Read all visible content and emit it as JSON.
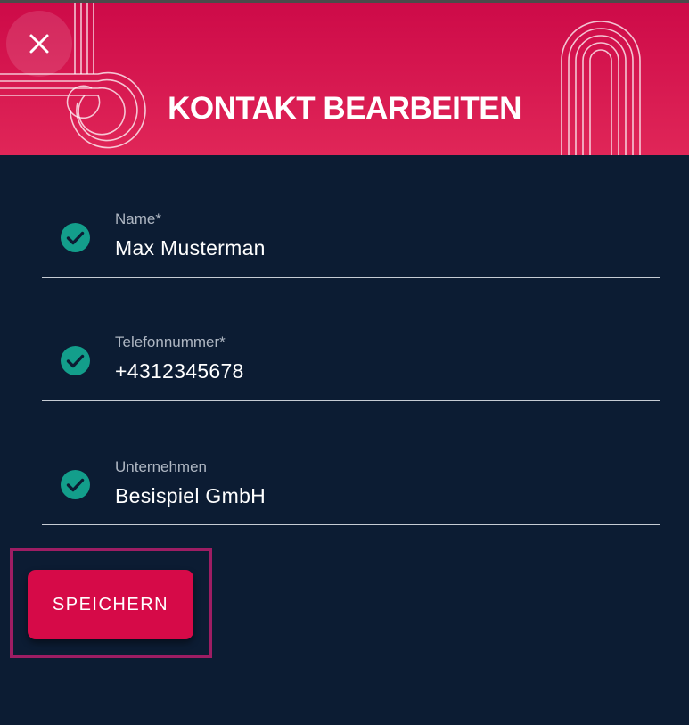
{
  "dialog": {
    "title": "KONTAKT BEARBEITEN",
    "close_icon": "close-icon",
    "accent_color": "#d60a48",
    "background_color": "#0c1c33"
  },
  "form": {
    "fields": [
      {
        "label": "Name*",
        "value": "Max Musterman",
        "status_icon": "check-circle-icon",
        "status_color": "#139e8b"
      },
      {
        "label": "Telefonnummer*",
        "value": "+4312345678",
        "status_icon": "check-circle-icon",
        "status_color": "#139e8b"
      },
      {
        "label": "Unternehmen",
        "value": "Besispiel GmbH",
        "status_icon": "check-circle-icon",
        "status_color": "#139e8b"
      }
    ]
  },
  "actions": {
    "save_label": "SPEICHERN"
  }
}
